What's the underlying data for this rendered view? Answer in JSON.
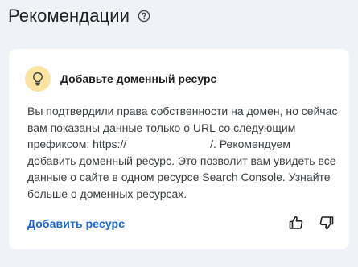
{
  "header": {
    "title": "Рекомендации",
    "help_icon": "help-circle-icon"
  },
  "card": {
    "icon": "lightbulb-icon",
    "icon_bg": "#fbe3a2",
    "title": "Добавьте доменный ресурс",
    "body_part1": "Вы подтвердили права собственности на домен, но сейчас вам показаны данные только о URL со следующим префиксом: https://",
    "body_part2": "/. Рекомендуем добавить доменный ресурс. Это позволит вам увидеть все данные о сайте в одном ресурсе Search Console. Узнайте больше о доменных ресурсах.",
    "action_label": "Добавить ресурс",
    "action_color": "#1a66d6",
    "feedback": {
      "thumb_up_icon": "thumb-up-icon",
      "thumb_down_icon": "thumb-down-icon"
    }
  },
  "colors": {
    "page_bg": "#eff2f7",
    "card_bg": "#ffffff"
  }
}
